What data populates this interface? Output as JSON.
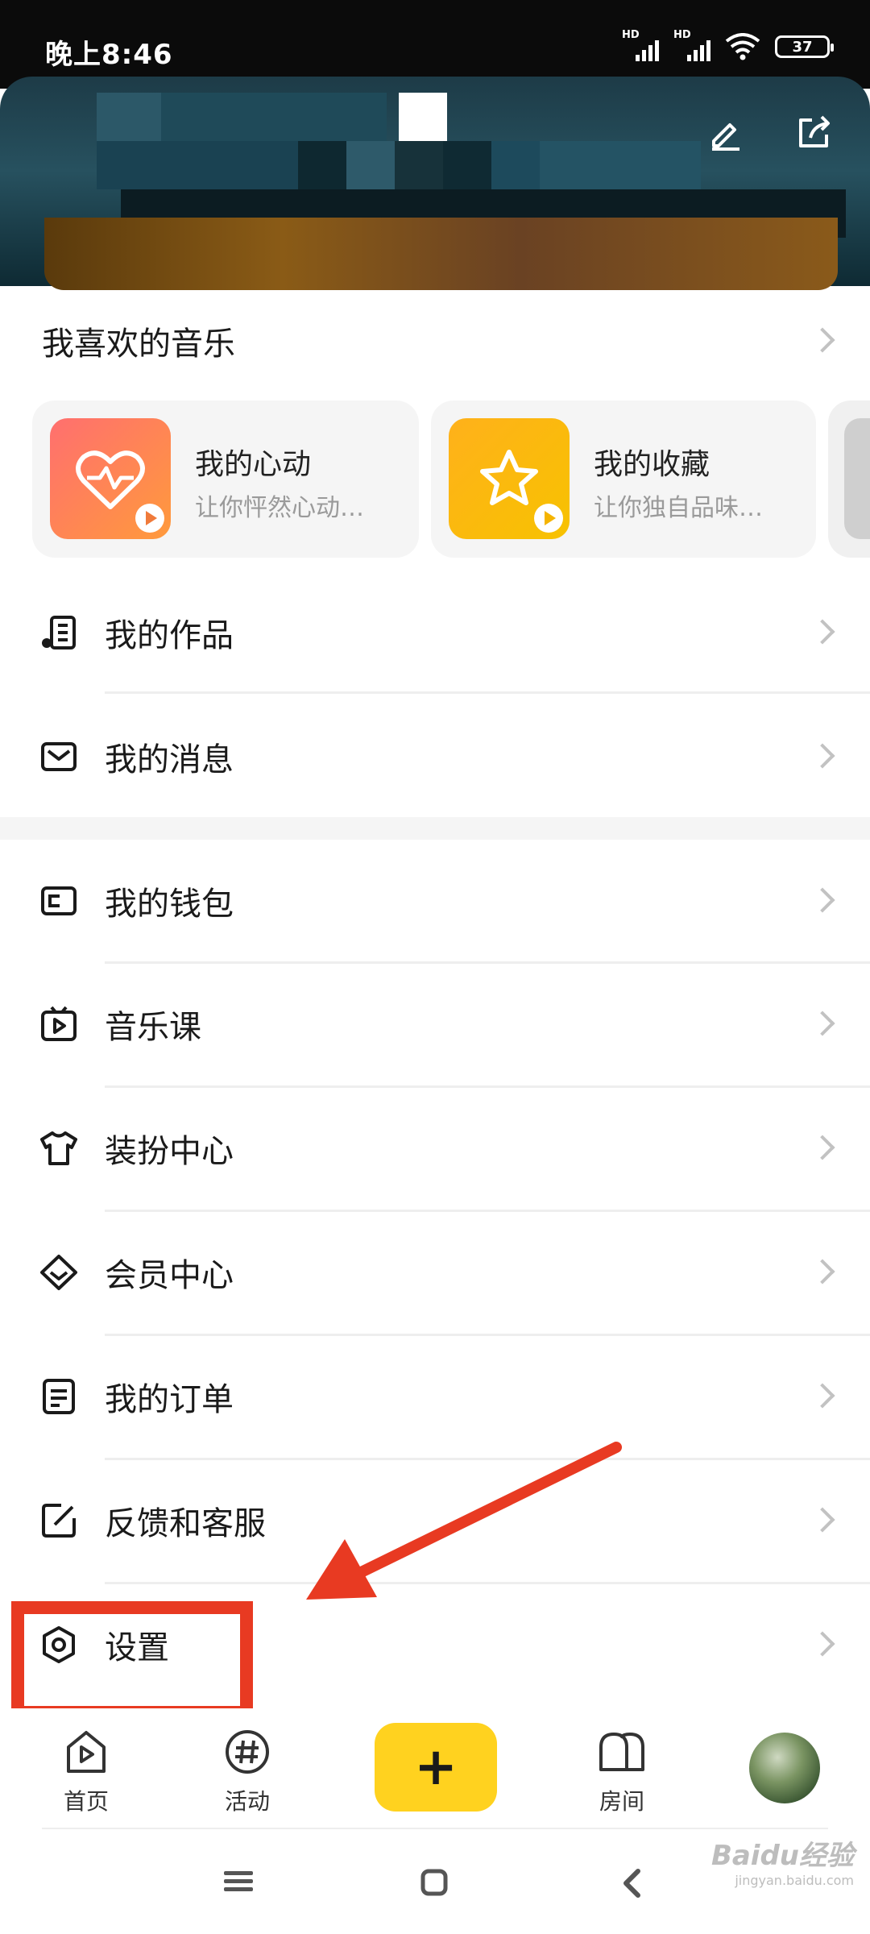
{
  "status_bar": {
    "time": "晚上8:46",
    "battery": "37",
    "signal_labels": [
      "HD",
      "HD"
    ]
  },
  "header": {
    "edit_icon": "edit-icon",
    "share_icon": "share-icon"
  },
  "favorites": {
    "title": "我喜欢的音乐",
    "tiles": [
      {
        "title": "我的心动",
        "subtitle": "让你怦然心动…",
        "color_from": "#ff6f6f",
        "color_to": "#ff9a3c",
        "icon": "heartbeat-icon"
      },
      {
        "title": "我的收藏",
        "subtitle": "让你独自品味…",
        "color_from": "#ffb11b",
        "color_to": "#f7c200",
        "icon": "star-icon"
      }
    ]
  },
  "menu": {
    "works": "我的作品",
    "messages": "我的消息",
    "wallet": "我的钱包",
    "music_class": "音乐课",
    "dressup": "装扮中心",
    "vip": "会员中心",
    "orders": "我的订单",
    "feedback": "反馈和客服",
    "settings": "设置"
  },
  "bottom_nav": {
    "home": "首页",
    "activity": "活动",
    "rooms": "房间",
    "plus": "+"
  },
  "watermark": {
    "brand": "Baidu经验",
    "url": "jingyan.baidu.com"
  },
  "colors": {
    "accent_yellow": "#ffd21f",
    "annotation_red": "#e83a22"
  }
}
